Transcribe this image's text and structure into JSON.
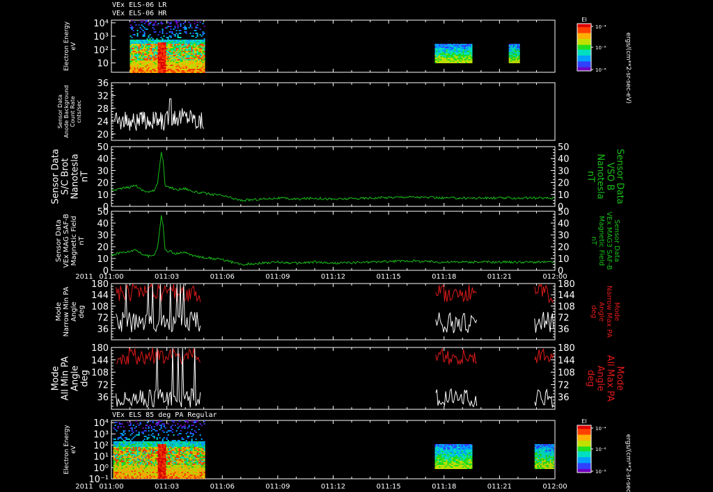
{
  "header": {
    "line1": "VEx ELS-06 LR",
    "line2": "VEx ELS-06 HR"
  },
  "footer_title": "VEx ELS 85 deg PA Regular",
  "year_label": "2011",
  "colors": {
    "white": "#ffffff",
    "green": "#19c019",
    "red": "#e01a1a",
    "background": "#000000"
  },
  "colorbar": {
    "title": "EI",
    "ticks": [
      "10⁻⁴",
      "10⁻⁶",
      "10⁻⁸"
    ],
    "unit_label": "ergs/(cm**2-sr-sec-eV)"
  },
  "chart_data": [
    {
      "type": "heatmap",
      "name": "panel1",
      "ylabel_lines": [
        "Electron Energy",
        "eV"
      ],
      "ytick_labels": [
        "10",
        "10²",
        "10³",
        "10⁴"
      ],
      "yscale": "log",
      "data_intervals_hours": [
        [
          1.0,
          5.0
        ],
        [
          17.5,
          19.5
        ],
        [
          21.5,
          22.1
        ]
      ]
    },
    {
      "type": "line",
      "name": "panel2",
      "ylabel_lines": [
        "Sensor Data",
        "Anode Background",
        "Count Rate",
        "cnts/sec"
      ],
      "ylim": [
        18,
        36
      ],
      "ytick_labels": [
        "20",
        "24",
        "28",
        "32",
        "36"
      ],
      "series": [
        {
          "color": "#ffffff",
          "x_range_hours": [
            1.0,
            5.0
          ],
          "y_range": [
            20,
            30
          ]
        }
      ]
    },
    {
      "type": "line",
      "name": "panel3",
      "ylabel_lines": [
        "Sensor Data",
        "S/C Brot",
        "Nanotesla",
        "nT"
      ],
      "right_label_lines": [
        "Sensor Data",
        "VSO B",
        "Nanotesla",
        "nT"
      ],
      "ylim": [
        0,
        50
      ],
      "ytick_labels": [
        "0",
        "10",
        "20",
        "30",
        "40",
        "50"
      ],
      "series": [
        {
          "color": "#19c019",
          "x": [
            0,
            0.5,
            1.0,
            1.3,
            1.6,
            2.0,
            2.3,
            2.5,
            2.7,
            2.8,
            2.9,
            3.0,
            3.2,
            3.5,
            4.0,
            4.5,
            5.0,
            5.5,
            6.0,
            7.0,
            8.0,
            9.0,
            10.0,
            11.0,
            12.0,
            14.0,
            16.0,
            18.0,
            20.0,
            22.0,
            24.0
          ],
          "y": [
            13,
            15,
            16,
            18,
            14,
            12,
            13,
            20,
            45,
            38,
            18,
            16,
            16,
            14,
            15,
            12,
            11,
            10,
            9,
            5,
            6,
            7,
            6,
            7,
            6,
            7,
            8,
            7,
            7,
            7,
            7
          ]
        }
      ]
    },
    {
      "type": "line",
      "name": "panel4",
      "ylabel_lines": [
        "Sensor Data",
        "VEx MAG SAF-B",
        "Magnetic Field",
        "nT"
      ],
      "right_label_lines": [
        "Sensor Data",
        "VEx MAG3 SAF-B",
        "Magnetic Field",
        "nT"
      ],
      "ylim": [
        0,
        50
      ],
      "ytick_labels": [
        "0",
        "10",
        "20",
        "30",
        "40",
        "50"
      ],
      "series": [
        {
          "color": "#19c019",
          "x": [
            0,
            0.5,
            1.0,
            1.3,
            1.6,
            2.0,
            2.3,
            2.5,
            2.7,
            2.8,
            2.9,
            3.0,
            3.2,
            3.5,
            4.0,
            4.5,
            5.0,
            5.5,
            6.0,
            7.0,
            8.0,
            9.0,
            10.0,
            11.0,
            12.0,
            14.0,
            16.0,
            18.0,
            20.0,
            22.0,
            24.0
          ],
          "y": [
            13,
            15,
            16,
            18,
            14,
            12,
            13,
            20,
            46,
            38,
            18,
            16,
            16,
            14,
            15,
            12,
            11,
            10,
            9,
            5,
            6,
            7,
            6,
            7,
            6,
            7,
            8,
            7,
            7,
            7,
            7
          ]
        }
      ]
    },
    {
      "type": "line",
      "name": "panel5",
      "ylabel_lines": [
        "Mode",
        "Narrow Min PA",
        "Angle",
        "deg"
      ],
      "right_label_lines": [
        "Mode",
        "Narrow Max PA",
        "Angle",
        "deg"
      ],
      "ylim": [
        0,
        180
      ],
      "ytick_labels": [
        "36",
        "72",
        "108",
        "144",
        "180"
      ],
      "series": [
        {
          "color": "#e01a1a",
          "x_range_hours": [
            [
              0.2,
              4.8
            ],
            [
              17.5,
              19.8
            ],
            [
              22.9,
              23.9
            ]
          ],
          "y_range": [
            120,
            180
          ]
        },
        {
          "color": "#ffffff",
          "x_range_hours": [
            [
              0.2,
              4.8
            ],
            [
              17.5,
              19.8
            ],
            [
              22.9,
              23.9
            ]
          ],
          "y_range": [
            20,
            90
          ]
        }
      ]
    },
    {
      "type": "line",
      "name": "panel6",
      "ylabel_lines": [
        "Mode",
        "All Min PA",
        "Angle",
        "deg"
      ],
      "right_label_lines": [
        "Mode",
        "All Max PA",
        "Angle",
        "deg"
      ],
      "ylim": [
        0,
        180
      ],
      "ytick_labels": [
        "36",
        "72",
        "108",
        "144",
        "180"
      ],
      "series": [
        {
          "color": "#e01a1a",
          "x_range_hours": [
            [
              0.2,
              4.8
            ],
            [
              17.5,
              19.8
            ],
            [
              22.9,
              23.9
            ]
          ],
          "y_range": [
            130,
            180
          ]
        },
        {
          "color": "#ffffff",
          "x_range_hours": [
            [
              0.2,
              4.8
            ],
            [
              17.5,
              19.8
            ],
            [
              22.9,
              23.9
            ]
          ],
          "y_range": [
            5,
            60
          ]
        }
      ]
    },
    {
      "type": "heatmap",
      "name": "panel7",
      "ylabel_lines": [
        "Electron Energy",
        "eV"
      ],
      "ytick_labels": [
        "10⁻¹",
        "10⁰",
        "10¹",
        "10²",
        "10³",
        "10⁴"
      ],
      "yscale": "log",
      "data_intervals_hours": [
        [
          0.1,
          5.0
        ],
        [
          17.5,
          19.5
        ],
        [
          22.9,
          23.9
        ]
      ]
    }
  ],
  "x_axis": {
    "xlim_hours": [
      0,
      24
    ],
    "tick_labels": [
      "011:00",
      "011:03",
      "011:06",
      "011:09",
      "011:12",
      "011:15",
      "011:18",
      "011:21",
      "012:00"
    ]
  }
}
